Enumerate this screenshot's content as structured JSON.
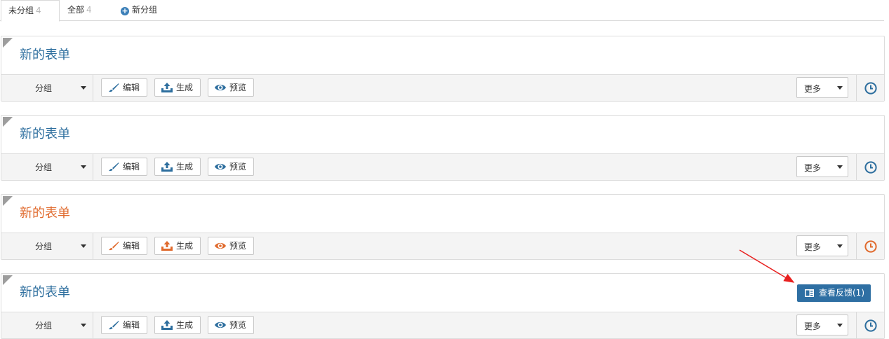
{
  "tabs": [
    {
      "label": "未分组",
      "count": "4"
    },
    {
      "label": "全部",
      "count": "4"
    },
    {
      "label": "新分组"
    }
  ],
  "colors": {
    "blue": "#2d6e9e",
    "orange": "#e06a2d",
    "feedback": "#2e6fa3",
    "arrow": "#e8201f"
  },
  "forms": [
    {
      "title": "新的表单",
      "theme": "blue"
    },
    {
      "title": "新的表单",
      "theme": "blue"
    },
    {
      "title": "新的表单",
      "theme": "orange"
    },
    {
      "title": "新的表单",
      "theme": "blue",
      "feedback_label": "查看反馈(1)"
    }
  ],
  "toolbar": {
    "group_label": "分组",
    "edit_label": "编辑",
    "generate_label": "生成",
    "preview_label": "预览",
    "more_label": "更多"
  }
}
